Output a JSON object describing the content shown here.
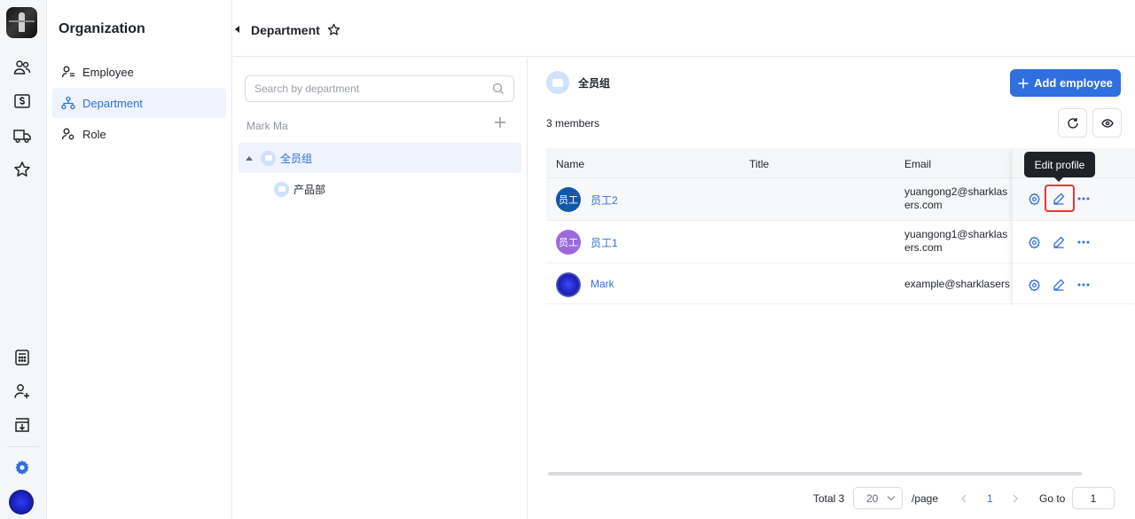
{
  "rail": {
    "items": [
      "people-icon",
      "billing-icon",
      "truck-icon",
      "star-icon",
      "calculator-icon",
      "add-user-icon",
      "download-icon",
      "settings-icon"
    ]
  },
  "sidebar": {
    "title": "Organization",
    "items": [
      {
        "label": "Employee",
        "icon": "employee-icon"
      },
      {
        "label": "Department",
        "icon": "department-icon",
        "active": true
      },
      {
        "label": "Role",
        "icon": "role-icon"
      }
    ]
  },
  "header": {
    "title": "Department"
  },
  "tree": {
    "search_placeholder": "Search by department",
    "owner": "Mark Ma",
    "nodes": [
      {
        "label": "全员组",
        "selected": true
      },
      {
        "label": "产品部"
      }
    ]
  },
  "main": {
    "group_name": "全员组",
    "add_label": "Add employee",
    "members": "3 members",
    "columns": {
      "name": "Name",
      "title": "Title",
      "email": "Email"
    },
    "rows": [
      {
        "avatar_text": "员工",
        "name": "员工2",
        "title": "",
        "email": "yuangong2@sharklasers.com",
        "avatar_color": "#1456a8"
      },
      {
        "avatar_text": "员工",
        "name": "员工1",
        "title": "",
        "email": "yuangong1@sharklasers.com",
        "avatar_color": "#9c6ade"
      },
      {
        "avatar_text": "",
        "name": "Mark",
        "title": "",
        "email": "example@sharklasers.com",
        "avatar_color": "#1a1fb0"
      }
    ],
    "tooltip": "Edit profile"
  },
  "pagination": {
    "total": "Total 3",
    "page_size": "20",
    "per_page": "/page",
    "current": "1",
    "goto_label": "Go to",
    "goto_value": "1"
  },
  "colors": {
    "accent": "#2f6fe0",
    "highlight": "#e03a3a"
  }
}
